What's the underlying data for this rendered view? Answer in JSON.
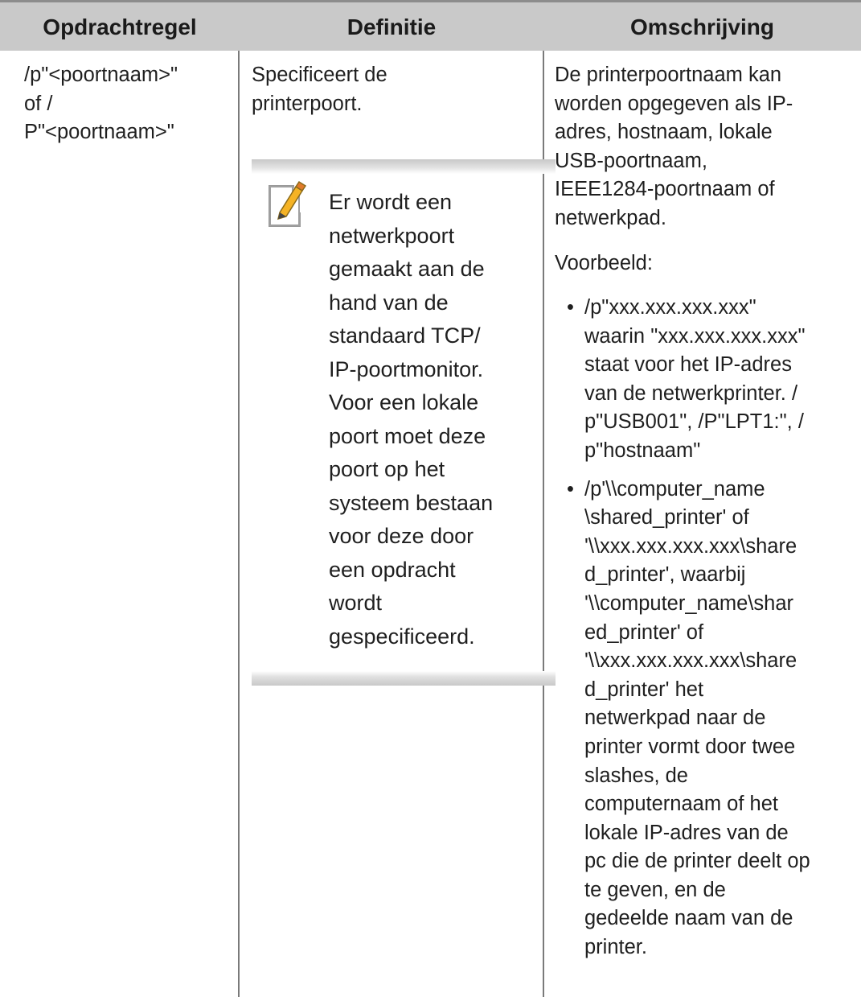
{
  "table": {
    "headers": [
      "Opdrachtregel",
      "Definitie",
      "Omschrijving"
    ],
    "command": [
      "/p\"<poortnaam>\"",
      "of /",
      "P\"<poortnaam>\""
    ],
    "definition": [
      "Specificeert de",
      "printerpoort."
    ],
    "note": {
      "icon": "note-pencil-icon",
      "lines": [
        "Er wordt een",
        "netwerkpoort",
        "gemaakt aan de",
        "hand van de",
        "standaard TCP/",
        "IP-poortmonitor.",
        "Voor een lokale",
        "poort moet deze",
        "poort op het",
        "systeem bestaan",
        "voor deze door",
        "een opdracht",
        "wordt",
        "gespecificeerd."
      ]
    },
    "description": {
      "intro": [
        "De printerpoortnaam kan",
        "worden opgegeven als IP-",
        "adres, hostnaam, lokale",
        "USB-poortnaam,",
        "IEEE1284-poortnaam of",
        "netwerkpad."
      ],
      "example_label": "Voorbeeld:",
      "bullets": [
        {
          "lines": [
            "/p\"xxx.xxx.xxx.xxx\"",
            "waarin \"xxx.xxx.xxx.xxx\"",
            "staat voor het IP-adres",
            "van de netwerkprinter. /",
            "p\"USB001\", /P\"LPT1:\", /",
            "p\"hostnaam\""
          ]
        },
        {
          "lines": [
            "/p'\\\\computer_name",
            "\\shared_printer' of",
            "'\\\\xxx.xxx.xxx.xxx\\share",
            "d_printer', waarbij",
            "'\\\\computer_name\\shar",
            "ed_printer' of",
            "'\\\\xxx.xxx.xxx.xxx\\share",
            "d_printer' het",
            "netwerkpad naar de",
            "printer vormt door twee",
            "slashes, de",
            "computernaam of het",
            "lokale IP-adres van de",
            "pc die de printer deelt op",
            "te geven, en de",
            "gedeelde naam van de",
            "printer."
          ]
        }
      ]
    }
  }
}
